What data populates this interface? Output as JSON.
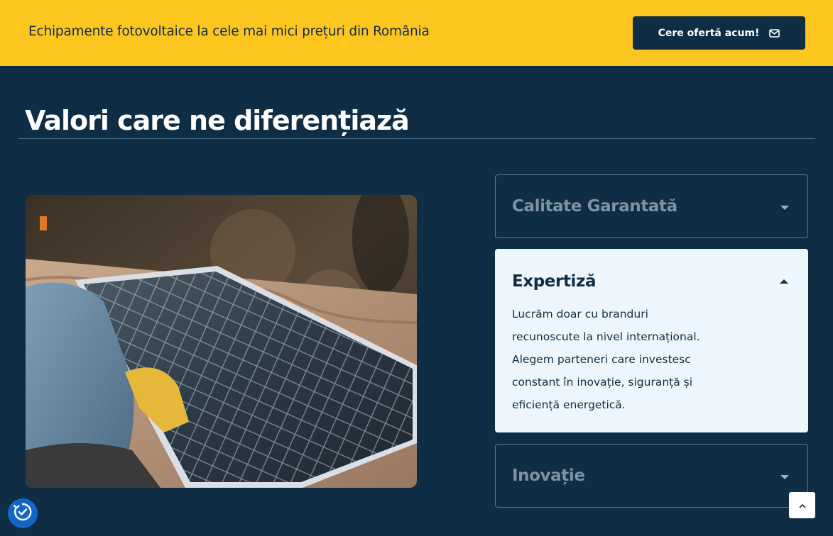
{
  "topbar": {
    "tagline": "Echipamente fotovoltaice la cele mai mici prețuri din România",
    "cta_label": "Cere ofertă acum!",
    "cta_icon": "mail-icon",
    "background": "#fdc61e"
  },
  "section": {
    "title": "Valori care ne diferențiază",
    "image_alt": "Tehnician montând un panou solar pe acoperiș"
  },
  "accordion": {
    "items": [
      {
        "title": "Calitate Garantată",
        "expanded": false
      },
      {
        "title": "Expertiză",
        "expanded": true,
        "body_lines": [
          "Lucrăm doar cu branduri",
          "recunoscute la nivel internațional.",
          "Alegem parteneri care investesc",
          "constant în inovație, siguranță și",
          "eficiență energetică."
        ]
      },
      {
        "title": "Inovație",
        "expanded": false
      }
    ]
  },
  "colors": {
    "brand_navy": "#0f2d44",
    "accent_yellow": "#fdc61e",
    "panel_light": "#eef6fd",
    "a11y_blue": "#1466c6"
  },
  "widgets": {
    "scroll_top_icon": "chevron-up-icon",
    "accessibility_icon": "accessibility-icon"
  }
}
